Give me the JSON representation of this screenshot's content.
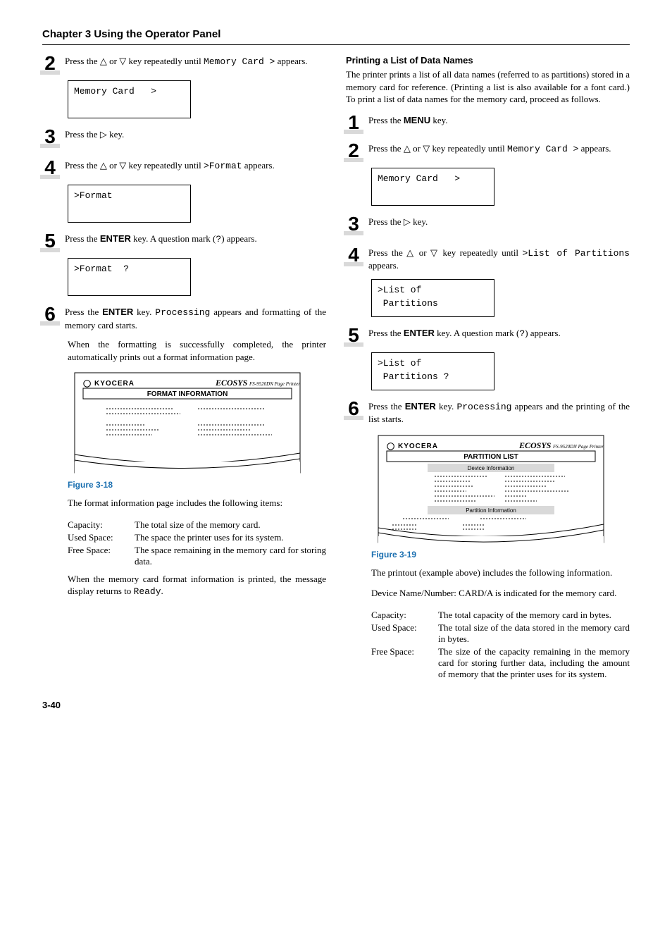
{
  "chapterTitle": "Chapter 3  Using the Operator Panel",
  "pageNumber": "3-40",
  "left": {
    "step2": "Press the △ or ▽ key repeatedly until Memory Card > appears.",
    "lcd1": "Memory Card   >",
    "step3": "Press the ▷ key.",
    "step4": "Press the △ or ▽ key repeatedly until >Format appears.",
    "lcd2": ">Format",
    "step5": "Press the ENTER key. A question mark (?) appears.",
    "lcd3": ">Format  ?",
    "step6": "Press the ENTER key. Processing appears and formatting of the memory card starts.",
    "step6b": "When the formatting is successfully completed, the printer automatically prints out a format information page.",
    "formatSheet": {
      "brand": "KYOCERA",
      "logo": "ECOSYS",
      "model": "FS-9520DN  Page Printer",
      "title": "FORMAT INFORMATION"
    },
    "fig18": "Figure 3-18",
    "postFigA": "The format information page includes the following items:",
    "defs": {
      "capacityTerm": "Capacity:",
      "capacityDef": "The total size of the memory card.",
      "usedTerm": "Used Space:",
      "usedDef": "The space the printer uses for its system.",
      "freeTerm": "Free Space:",
      "freeDef": "The space remaining in the memory card for storing data."
    },
    "footer": "When the memory card format information is printed, the message display returns to Ready."
  },
  "right": {
    "heading": "Printing a List of Data Names",
    "intro": "The printer prints a list of all data names (referred to as partitions) stored in a memory card for reference. (Printing a list is also available for a font card.) To print a list of data names for the memory card, proceed as follows.",
    "step1": "Press the MENU key.",
    "step2": "Press the △ or ▽ key repeatedly until Memory Card > appears.",
    "lcd1": "Memory Card   >",
    "step3": "Press the ▷ key.",
    "step4": "Press the △ or ▽ key repeatedly until >List of Partitions appears.",
    "lcd2": ">List of\n Partitions",
    "step5": "Press the ENTER key. A question mark (?) appears.",
    "lcd3": ">List of\n Partitions ?",
    "step6": "Press the ENTER key. Processing appears and the printing of the list starts.",
    "partitionSheet": {
      "brand": "KYOCERA",
      "logo": "ECOSYS",
      "model": "FS-9520DN  Page Printer",
      "title": "PARTITION LIST",
      "sec1": "Device Information",
      "sec2": "Partition Information"
    },
    "fig19": "Figure 3-19",
    "postFigA": "The printout (example above) includes the following information.",
    "deviceLine": "Device Name/Number: CARD/A is indicated for the memory card.",
    "defs": {
      "capacityTerm": "Capacity:",
      "capacityDef": "The total capacity of the memory card in bytes.",
      "usedTerm": "Used Space:",
      "usedDef": "The total size of the data stored in the memory card in bytes.",
      "freeTerm": "Free Space:",
      "freeDef": "The size of the capacity remaining in the memory card for storing further data, including the amount of memory that the printer uses for its system."
    }
  }
}
